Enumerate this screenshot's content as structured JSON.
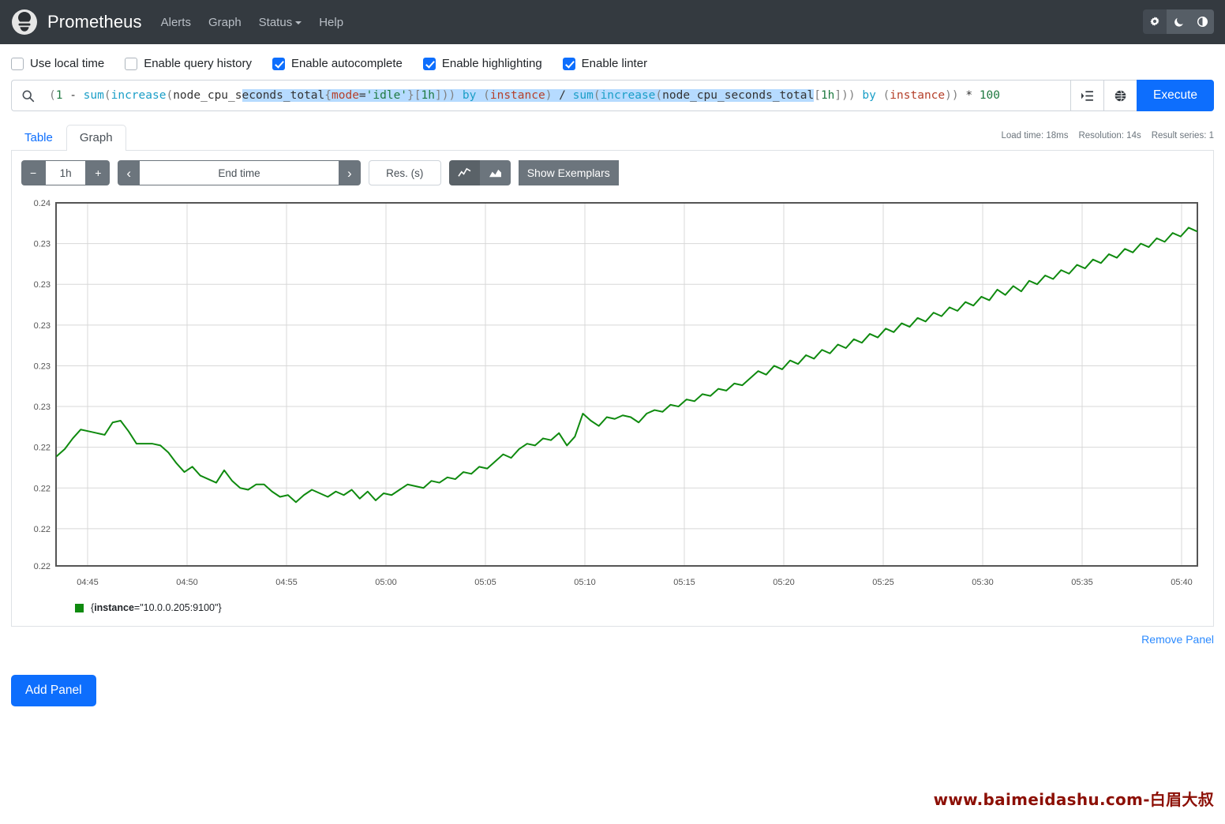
{
  "navbar": {
    "brand": "Prometheus",
    "logo_icon": "prometheus-logo-icon",
    "links": [
      {
        "label": "Alerts",
        "name": "nav-alerts"
      },
      {
        "label": "Graph",
        "name": "nav-graph"
      },
      {
        "label": "Status",
        "name": "nav-status",
        "has_caret": true
      },
      {
        "label": "Help",
        "name": "nav-help"
      }
    ],
    "theme_buttons": [
      {
        "icon": "sun-gear-icon",
        "label": "Light theme",
        "active": true
      },
      {
        "icon": "moon-icon",
        "label": "Dark theme",
        "active": false
      },
      {
        "icon": "half-circle-icon",
        "label": "Auto theme",
        "active": false
      }
    ]
  },
  "options": [
    {
      "label": "Use local time",
      "checked": false,
      "name": "use-local-time"
    },
    {
      "label": "Enable query history",
      "checked": false,
      "name": "enable-query-history"
    },
    {
      "label": "Enable autocomplete",
      "checked": true,
      "name": "enable-autocomplete"
    },
    {
      "label": "Enable highlighting",
      "checked": true,
      "name": "enable-highlighting"
    },
    {
      "label": "Enable linter",
      "checked": true,
      "name": "enable-linter"
    }
  ],
  "query": {
    "search_icon": "search-icon",
    "value": "(1 - sum(increase(node_cpu_seconds_total{mode='idle'}[1h])) by (instance) / sum(increase(node_cpu_seconds_total[1h])) by (instance)) * 100",
    "selection_text": "econds_total{mode='idle'}[1h])) by (instance) / sum(increase(node_cpu_seconds_total",
    "metrics_explorer_icon": "list-indent-icon",
    "globe_icon": "globe-icon",
    "execute_label": "Execute"
  },
  "tabs": [
    {
      "label": "Table",
      "active": false,
      "name": "tab-table"
    },
    {
      "label": "Graph",
      "active": true,
      "name": "tab-graph"
    }
  ],
  "meta": {
    "load_time": "Load time: 18ms",
    "resolution": "Resolution: 14s",
    "result_series": "Result series: 1"
  },
  "graph_toolbar": {
    "decrease_label": "−",
    "range_value": "1h",
    "increase_label": "+",
    "prev_label": "‹",
    "end_time_placeholder": "End time",
    "next_label": "›",
    "resolution_placeholder": "Res. (s)",
    "line_chart_icon": "line-chart-icon",
    "stacked_chart_icon": "stacked-area-chart-icon",
    "show_exemplars_label": "Show Exemplars"
  },
  "legend": {
    "color": "#0f8a0f",
    "label_key": "instance",
    "label_text": "{instance=\"10.0.0.205:9100\"}"
  },
  "footer": {
    "remove_panel_label": "Remove Panel",
    "add_panel_label": "Add Panel",
    "watermark": "www.baimeidashu.com-白眉大叔"
  },
  "chart_data": {
    "type": "line",
    "title": "",
    "xlabel": "",
    "ylabel": "",
    "grid": true,
    "legend_position": "bottom-left",
    "line_color": "#0f8a0f",
    "ylim": [
      0.215,
      0.2355
    ],
    "ytick_labels": [
      "0.24",
      "0.23",
      "0.23",
      "0.23",
      "0.23",
      "0.23",
      "0.22",
      "0.22",
      "0.22",
      "0.22"
    ],
    "ytick_values": [
      0.2355,
      0.2332,
      0.2309,
      0.2286,
      0.2263,
      0.224,
      0.2217,
      0.2194,
      0.2171,
      0.215
    ],
    "xtick_labels": [
      "04:45",
      "04:50",
      "04:55",
      "05:00",
      "05:05",
      "05:10",
      "05:15",
      "05:20",
      "05:25",
      "05:30",
      "05:35",
      "05:40"
    ],
    "xlim": [
      "04:43",
      "05:43"
    ],
    "series": [
      {
        "name": "{instance=\"10.0.0.205:9100\"}",
        "color": "#0f8a0f",
        "values": [
          0.2212,
          0.2216,
          0.2222,
          0.2227,
          0.2226,
          0.2225,
          0.2224,
          0.2231,
          0.2232,
          0.2226,
          0.2219,
          0.2219,
          0.2219,
          0.2218,
          0.2214,
          0.2208,
          0.2203,
          0.2206,
          0.2201,
          0.2199,
          0.2197,
          0.2204,
          0.2198,
          0.2194,
          0.2193,
          0.2196,
          0.2196,
          0.2192,
          0.2189,
          0.219,
          0.2186,
          0.219,
          0.2193,
          0.2191,
          0.2189,
          0.2192,
          0.219,
          0.2193,
          0.2188,
          0.2192,
          0.2187,
          0.2191,
          0.219,
          0.2193,
          0.2196,
          0.2195,
          0.2194,
          0.2198,
          0.2197,
          0.22,
          0.2199,
          0.2203,
          0.2202,
          0.2206,
          0.2205,
          0.2209,
          0.2213,
          0.2211,
          0.2216,
          0.2219,
          0.2218,
          0.2222,
          0.2221,
          0.2225,
          0.2218,
          0.2223,
          0.2236,
          0.2232,
          0.2229,
          0.2234,
          0.2233,
          0.2235,
          0.2234,
          0.2231,
          0.2236,
          0.2238,
          0.2237,
          0.2241,
          0.224,
          0.2244,
          0.2243,
          0.2247,
          0.2246,
          0.225,
          0.2249,
          0.2253,
          0.2252,
          0.2256,
          0.226,
          0.2258,
          0.2263,
          0.2261,
          0.2266,
          0.2264,
          0.2269,
          0.2267,
          0.2272,
          0.227,
          0.2275,
          0.2273,
          0.2278,
          0.2276,
          0.2281,
          0.2279,
          0.2284,
          0.2282,
          0.2287,
          0.2285,
          0.229,
          0.2288,
          0.2293,
          0.2291,
          0.2296,
          0.2294,
          0.2299,
          0.2297,
          0.2302,
          0.23,
          0.2306,
          0.2303,
          0.2308,
          0.2305,
          0.2311,
          0.2309,
          0.2314,
          0.2312,
          0.2317,
          0.2315,
          0.232,
          0.2318,
          0.2323,
          0.2321,
          0.2326,
          0.2324,
          0.2329,
          0.2327,
          0.2332,
          0.233,
          0.2335,
          0.2333,
          0.2338,
          0.2336,
          0.2341,
          0.2339
        ]
      }
    ]
  }
}
